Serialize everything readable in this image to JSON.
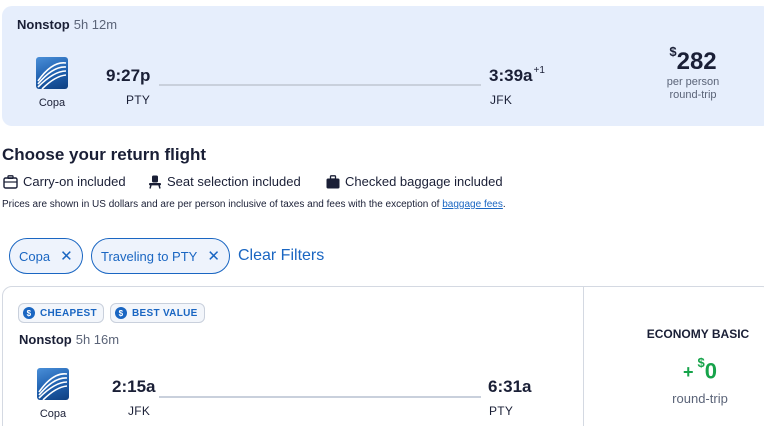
{
  "selected_flight": {
    "stops": "Nonstop",
    "duration": "5h 12m",
    "airline": "Copa",
    "depart_time": "9:27p",
    "depart_code": "PTY",
    "arrive_time": "3:39a",
    "arrive_day_offset": "+1",
    "arrive_code": "JFK",
    "price_symbol": "$",
    "price_amount": "282",
    "price_line1": "per person",
    "price_line2": "round-trip"
  },
  "section_title": "Choose your return flight",
  "inclusions": [
    {
      "label": "Carry-on included",
      "icon": "carry-on-bag-icon"
    },
    {
      "label": "Seat selection included",
      "icon": "seat-icon"
    },
    {
      "label": "Checked baggage included",
      "icon": "checked-bag-icon"
    }
  ],
  "disclaimer": {
    "text": "Prices are shown in US dollars and are per person inclusive of taxes and fees with the exception of ",
    "link": "baggage fees",
    "suffix": "."
  },
  "filters": {
    "chips": [
      "Copa",
      "Traveling to PTY"
    ],
    "clear_label": "Clear Filters"
  },
  "result": {
    "badges": [
      "CHEAPEST",
      "BEST VALUE"
    ],
    "stops": "Nonstop",
    "duration": "5h 16m",
    "airline": "Copa",
    "depart_time": "2:15a",
    "depart_code": "JFK",
    "arrive_time": "6:31a",
    "arrive_code": "PTY",
    "fare_name": "ECONOMY BASIC",
    "fare_plus": "+",
    "fare_symbol": "$",
    "fare_amount": "0",
    "fare_sub": "round-trip"
  },
  "colors": {
    "accent": "#1a66c2",
    "card_bg": "#e6eefc",
    "price_green": "#16a34a"
  }
}
